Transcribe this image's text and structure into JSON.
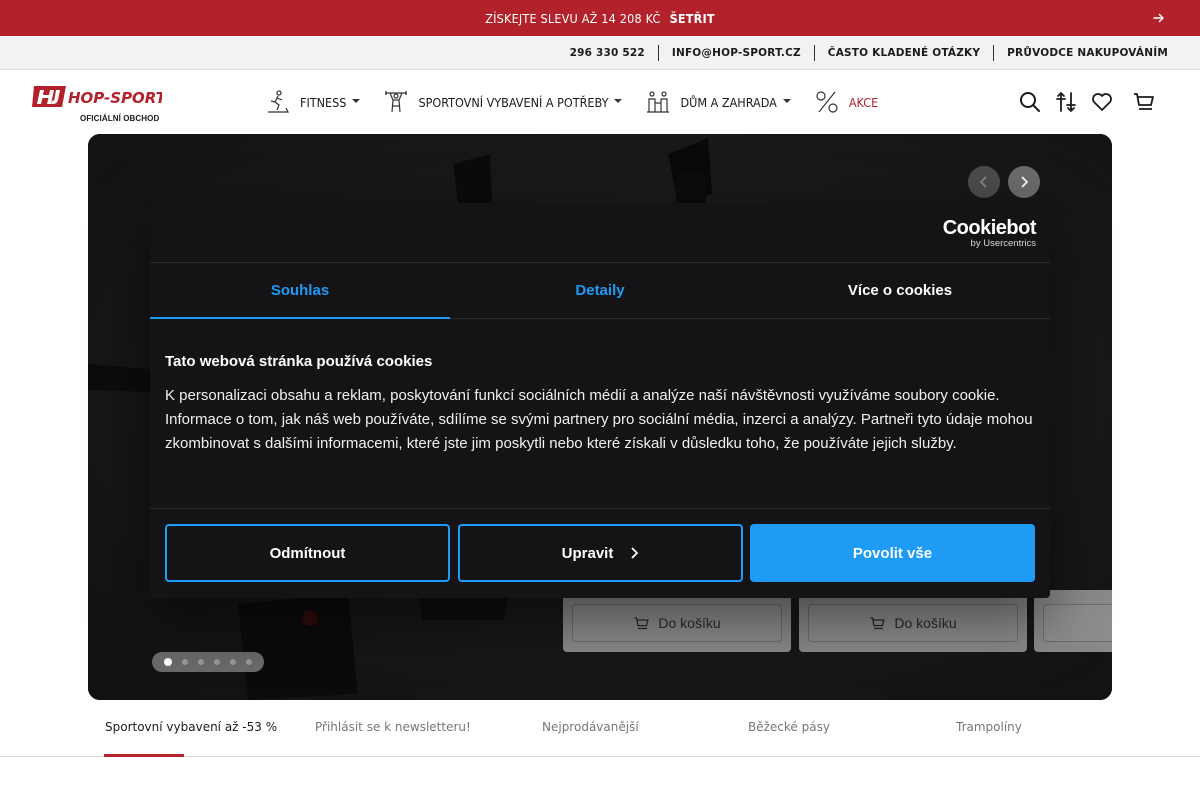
{
  "promo": {
    "text": "ZÍSKEJTE SLEVU AŽ 14 208 KČ",
    "cta": "ŠETŘIT",
    "arrow_icon": "arrow-right-icon"
  },
  "utility": {
    "phone": "296 330 522",
    "email": "INFO@HOP-SPORT.CZ",
    "faq": "ČASTO KLADENÉ OTÁZKY",
    "guide": "PRŮVODCE NAKUPOVÁNÍM"
  },
  "header": {
    "logo_text": "HOP-SPORT",
    "logo_sub": "OFICIÁLNÍ OBCHOD",
    "nav": [
      {
        "label": "FITNESS",
        "icon": "treadmill-icon"
      },
      {
        "label": "SPORTOVNÍ VYBAVENÍ A POTŘEBY",
        "icon": "weightlifter-icon"
      },
      {
        "label": "DŮM A ZAHRADA",
        "icon": "family-icon"
      },
      {
        "label": "AKCE",
        "icon": "percent-icon"
      }
    ],
    "icons": [
      "search-icon",
      "compare-icon",
      "heart-icon",
      "cart-icon"
    ]
  },
  "hero": {
    "product_buttons": [
      "Do košíku",
      "Do košíku"
    ],
    "slide_count": 6,
    "active_slide": 1
  },
  "cookie": {
    "brand": "Cookiebot",
    "brand_sub": "by Usercentrics",
    "tabs": [
      "Souhlas",
      "Detaily",
      "Více o cookies"
    ],
    "heading": "Tato webová stránka používá cookies",
    "text": "K personalizaci obsahu a reklam, poskytování funkcí sociálních médií a analýze naší návštěvnosti využíváme soubory cookie. Informace o tom, jak náš web používáte, sdílíme se svými partnery pro sociální média, inzerci a analýzy. Partneři tyto údaje mohou zkombinovat s dalšími informacemi, které jste jim poskytli nebo které získali v důsledku toho, že používáte jejich služby.",
    "buttons": {
      "deny": "Odmítnout",
      "customize": "Upravit",
      "allow": "Povolit vše"
    },
    "accent": "#1e9bf5"
  },
  "bottom_tabs": [
    "Sportovní vybavení až -53 %",
    "Přihlásit se k newsletteru!",
    "Nejprodávanější",
    "Běžecké pásy",
    "Trampolíny"
  ],
  "colors": {
    "brand_red": "#b3222a"
  }
}
